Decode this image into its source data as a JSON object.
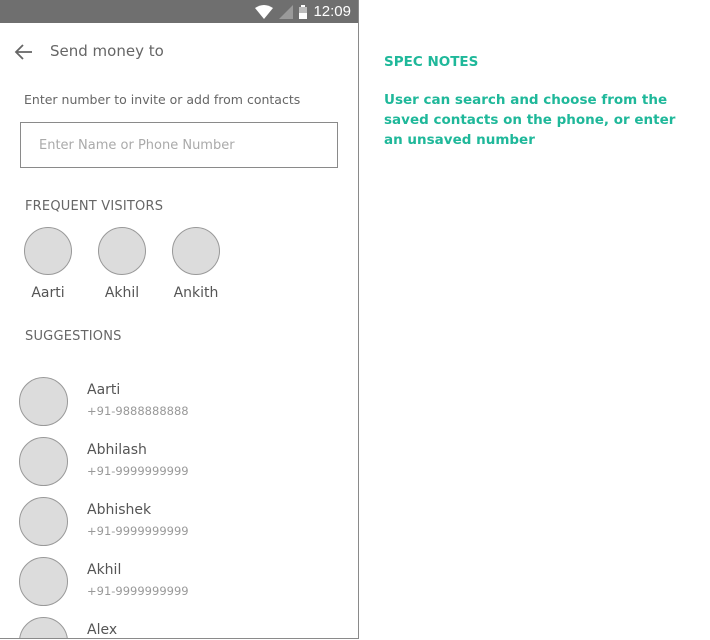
{
  "status_bar": {
    "time": "12:09",
    "icons": [
      "wifi-icon",
      "signal-icon",
      "battery-icon"
    ]
  },
  "header": {
    "title": "Send money to",
    "back_icon": "arrow-left-icon"
  },
  "search": {
    "hint": "Enter number to invite or add from contacts",
    "placeholder": "Enter Name or Phone Number",
    "value": ""
  },
  "frequent": {
    "label": "FREQUENT VISITORS",
    "items": [
      {
        "name": "Aarti"
      },
      {
        "name": "Akhil"
      },
      {
        "name": "Ankith"
      }
    ]
  },
  "suggestions": {
    "label": "SUGGESTIONS",
    "items": [
      {
        "name": "Aarti",
        "phone": "+91-9888888888"
      },
      {
        "name": "Abhilash",
        "phone": "+91-9999999999"
      },
      {
        "name": "Abhishek",
        "phone": "+91-9999999999"
      },
      {
        "name": "Akhil",
        "phone": "+91-9999999999"
      },
      {
        "name": "Alex",
        "phone": ""
      }
    ]
  },
  "notes": {
    "heading": "SPEC NOTES",
    "body": "User can search and choose from the saved contacts on the phone, or enter an unsaved number"
  },
  "colors": {
    "accent": "#1fb89a",
    "status_bar": "#6f6f6f",
    "avatar": "#dcdcdc"
  }
}
